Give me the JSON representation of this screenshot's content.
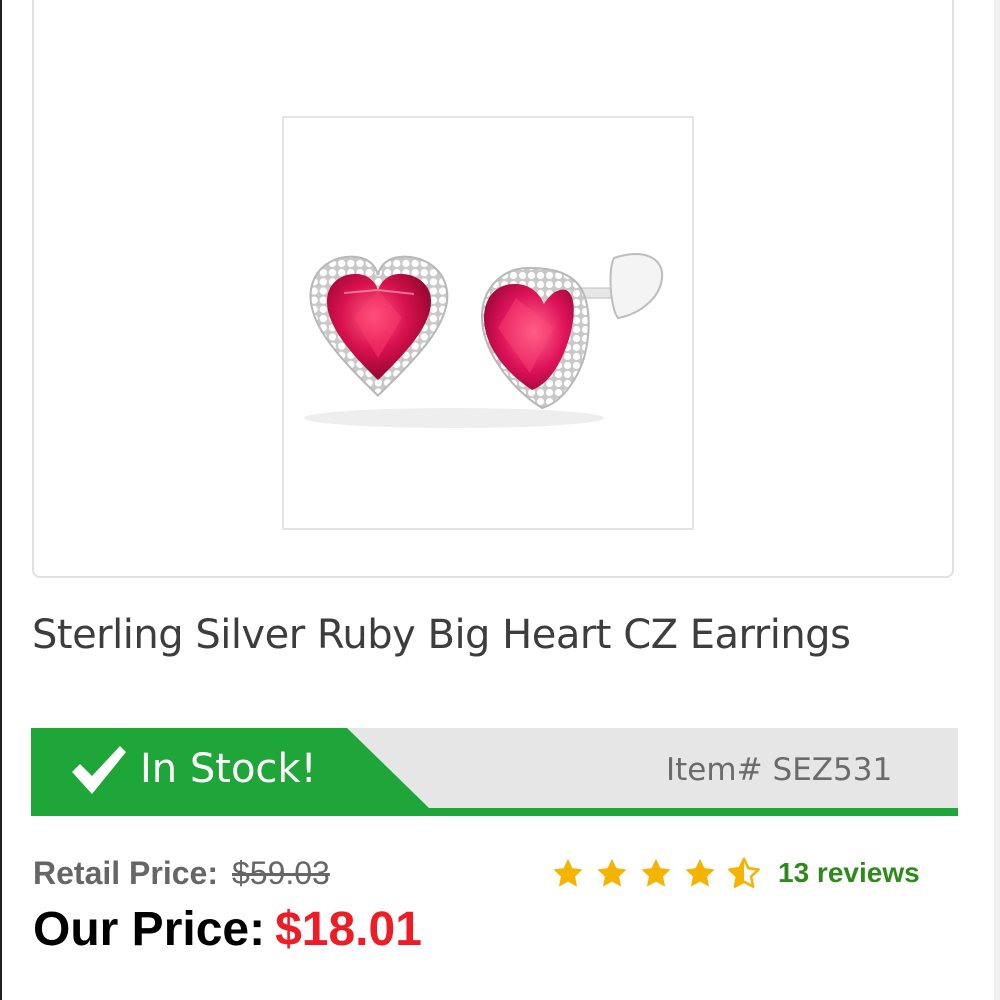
{
  "product": {
    "title": "Sterling Silver Ruby Big Heart CZ Earrings",
    "image_alt": "ruby-heart-earrings-photo"
  },
  "stock": {
    "label": "In Stock!",
    "item_label": "Item#",
    "item_number": "SEZ531",
    "icon": "checkmark-icon"
  },
  "pricing": {
    "retail_label": "Retail Price:",
    "retail_value": "$59.03",
    "our_label": "Our Price:",
    "our_value": "$18.01"
  },
  "rating": {
    "stars": 4.5,
    "max": 5,
    "reviews_text": "13 reviews"
  },
  "colors": {
    "stock_green": "#1fa638",
    "price_red": "#ee1c24",
    "star_gold": "#f5b400",
    "reviews_green": "#2f8a1c"
  }
}
